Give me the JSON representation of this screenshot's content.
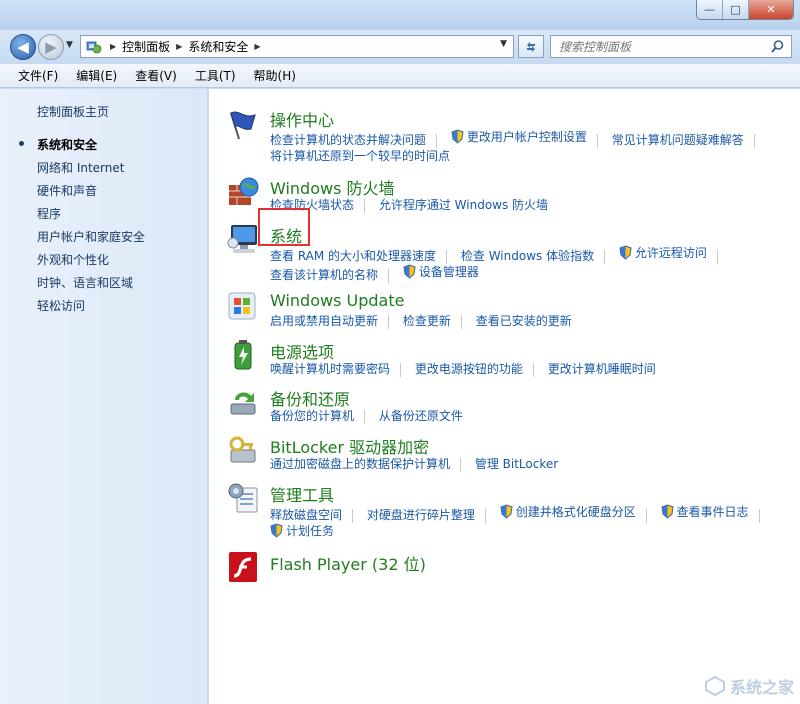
{
  "window": {
    "minimize": "—",
    "maximize": "□",
    "close": "✕"
  },
  "address": {
    "crumbs": [
      "控制面板",
      "系统和安全"
    ]
  },
  "search": {
    "placeholder": "搜索控制面板"
  },
  "menu": [
    "文件(F)",
    "编辑(E)",
    "查看(V)",
    "工具(T)",
    "帮助(H)"
  ],
  "left_nav": {
    "home": "控制面板主页",
    "items": [
      "系统和安全",
      "网络和 Internet",
      "硬件和声音",
      "程序",
      "用户帐户和家庭安全",
      "外观和个性化",
      "时钟、语言和区域",
      "轻松访问"
    ],
    "active_index": 0
  },
  "categories": [
    {
      "title": "操作中心",
      "icon": "flag-icon",
      "rows": [
        [
          {
            "text": "检查计算机的状态并解决问题",
            "shield": false
          },
          {
            "text": "更改用户帐户控制设置",
            "shield": true
          },
          {
            "text": "常见计算机问题疑难解答",
            "shield": false
          }
        ],
        [
          {
            "text": "将计算机还原到一个较早的时间点",
            "shield": false
          }
        ]
      ]
    },
    {
      "title": "Windows 防火墙",
      "icon": "firewall-icon",
      "rows": [
        [
          {
            "text": "检查防火墙状态",
            "shield": false
          },
          {
            "text": "允许程序通过 Windows 防火墙",
            "shield": false
          }
        ]
      ]
    },
    {
      "title": "系统",
      "icon": "system-icon",
      "rows": [
        [
          {
            "text": "查看 RAM 的大小和处理器速度",
            "shield": false
          },
          {
            "text": "检查 Windows 体验指数",
            "shield": false
          },
          {
            "text": "允许远程访问",
            "shield": true
          }
        ],
        [
          {
            "text": "查看该计算机的名称",
            "shield": false
          },
          {
            "text": "设备管理器",
            "shield": true
          }
        ]
      ]
    },
    {
      "title": "Windows Update",
      "icon": "windows-update-icon",
      "rows": [
        [
          {
            "text": "启用或禁用自动更新",
            "shield": false
          },
          {
            "text": "检查更新",
            "shield": false
          },
          {
            "text": "查看已安装的更新",
            "shield": false
          }
        ]
      ]
    },
    {
      "title": "电源选项",
      "icon": "power-icon",
      "rows": [
        [
          {
            "text": "唤醒计算机时需要密码",
            "shield": false
          },
          {
            "text": "更改电源按钮的功能",
            "shield": false
          },
          {
            "text": "更改计算机睡眠时间",
            "shield": false
          }
        ]
      ]
    },
    {
      "title": "备份和还原",
      "icon": "backup-icon",
      "rows": [
        [
          {
            "text": "备份您的计算机",
            "shield": false
          },
          {
            "text": "从备份还原文件",
            "shield": false
          }
        ]
      ]
    },
    {
      "title": "BitLocker 驱动器加密",
      "icon": "bitlocker-icon",
      "rows": [
        [
          {
            "text": "通过加密磁盘上的数据保护计算机",
            "shield": false
          },
          {
            "text": "管理 BitLocker",
            "shield": false
          }
        ]
      ]
    },
    {
      "title": "管理工具",
      "icon": "admin-tools-icon",
      "rows": [
        [
          {
            "text": "释放磁盘空间",
            "shield": false
          },
          {
            "text": "对硬盘进行碎片整理",
            "shield": false
          },
          {
            "text": "创建并格式化硬盘分区",
            "shield": true
          },
          {
            "text": "查看事件日志",
            "shield": true
          }
        ],
        [
          {
            "text": "计划任务",
            "shield": true
          }
        ]
      ]
    },
    {
      "title": "Flash Player (32 位)",
      "icon": "flash-player-icon",
      "rows": []
    }
  ],
  "watermark": "系统之家"
}
